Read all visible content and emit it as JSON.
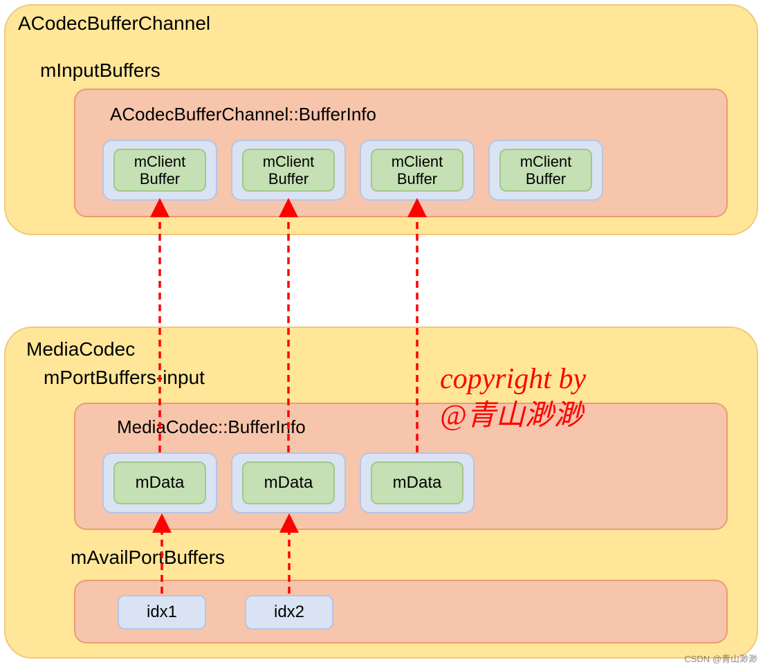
{
  "top": {
    "title": "ACodecBufferChannel",
    "group": "mInputBuffers",
    "inner_title": "ACodecBufferChannel::BufferInfo",
    "buffers": [
      "mClient\nBuffer",
      "mClient\nBuffer",
      "mClient\nBuffer",
      "mClient\nBuffer"
    ]
  },
  "bottom": {
    "title": "MediaCodec",
    "group": "mPortBuffers-input",
    "inner_title": "MediaCodec::BufferInfo",
    "buffers": [
      "mData",
      "mData",
      "mData"
    ],
    "avail_title": "mAvailPortBuffers",
    "idx": [
      "idx1",
      "idx2"
    ]
  },
  "watermark": {
    "line1": "copyright by",
    "line2": "@青山渺渺",
    "csdn": "CSDN @青山渺渺"
  }
}
